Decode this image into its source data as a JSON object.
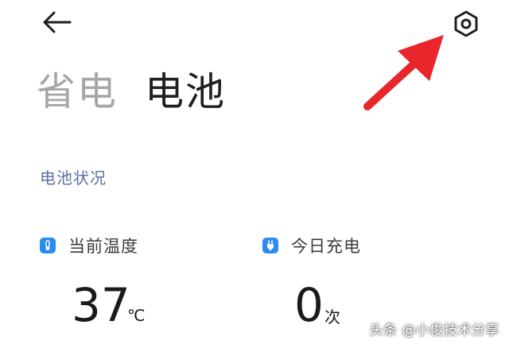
{
  "header": {
    "back_icon": "arrow-left-icon",
    "settings_icon": "gear-icon"
  },
  "tabs": [
    {
      "label": "省电",
      "active": false
    },
    {
      "label": "电池",
      "active": true
    }
  ],
  "section": {
    "title": "电池状况"
  },
  "stats": {
    "temperature": {
      "icon": "thermometer-icon",
      "label": "当前温度",
      "value": "37",
      "unit": "℃"
    },
    "charge_count": {
      "icon": "plug-icon",
      "label": "今日充电",
      "value": "0",
      "unit": "次"
    }
  },
  "watermark": "头条 @小俊技术分享",
  "colors": {
    "accent": "#2b8cf0",
    "section_title": "#5c6f9e",
    "inactive_tab": "#a6a6a6",
    "annotation_arrow": "#e8262b"
  }
}
